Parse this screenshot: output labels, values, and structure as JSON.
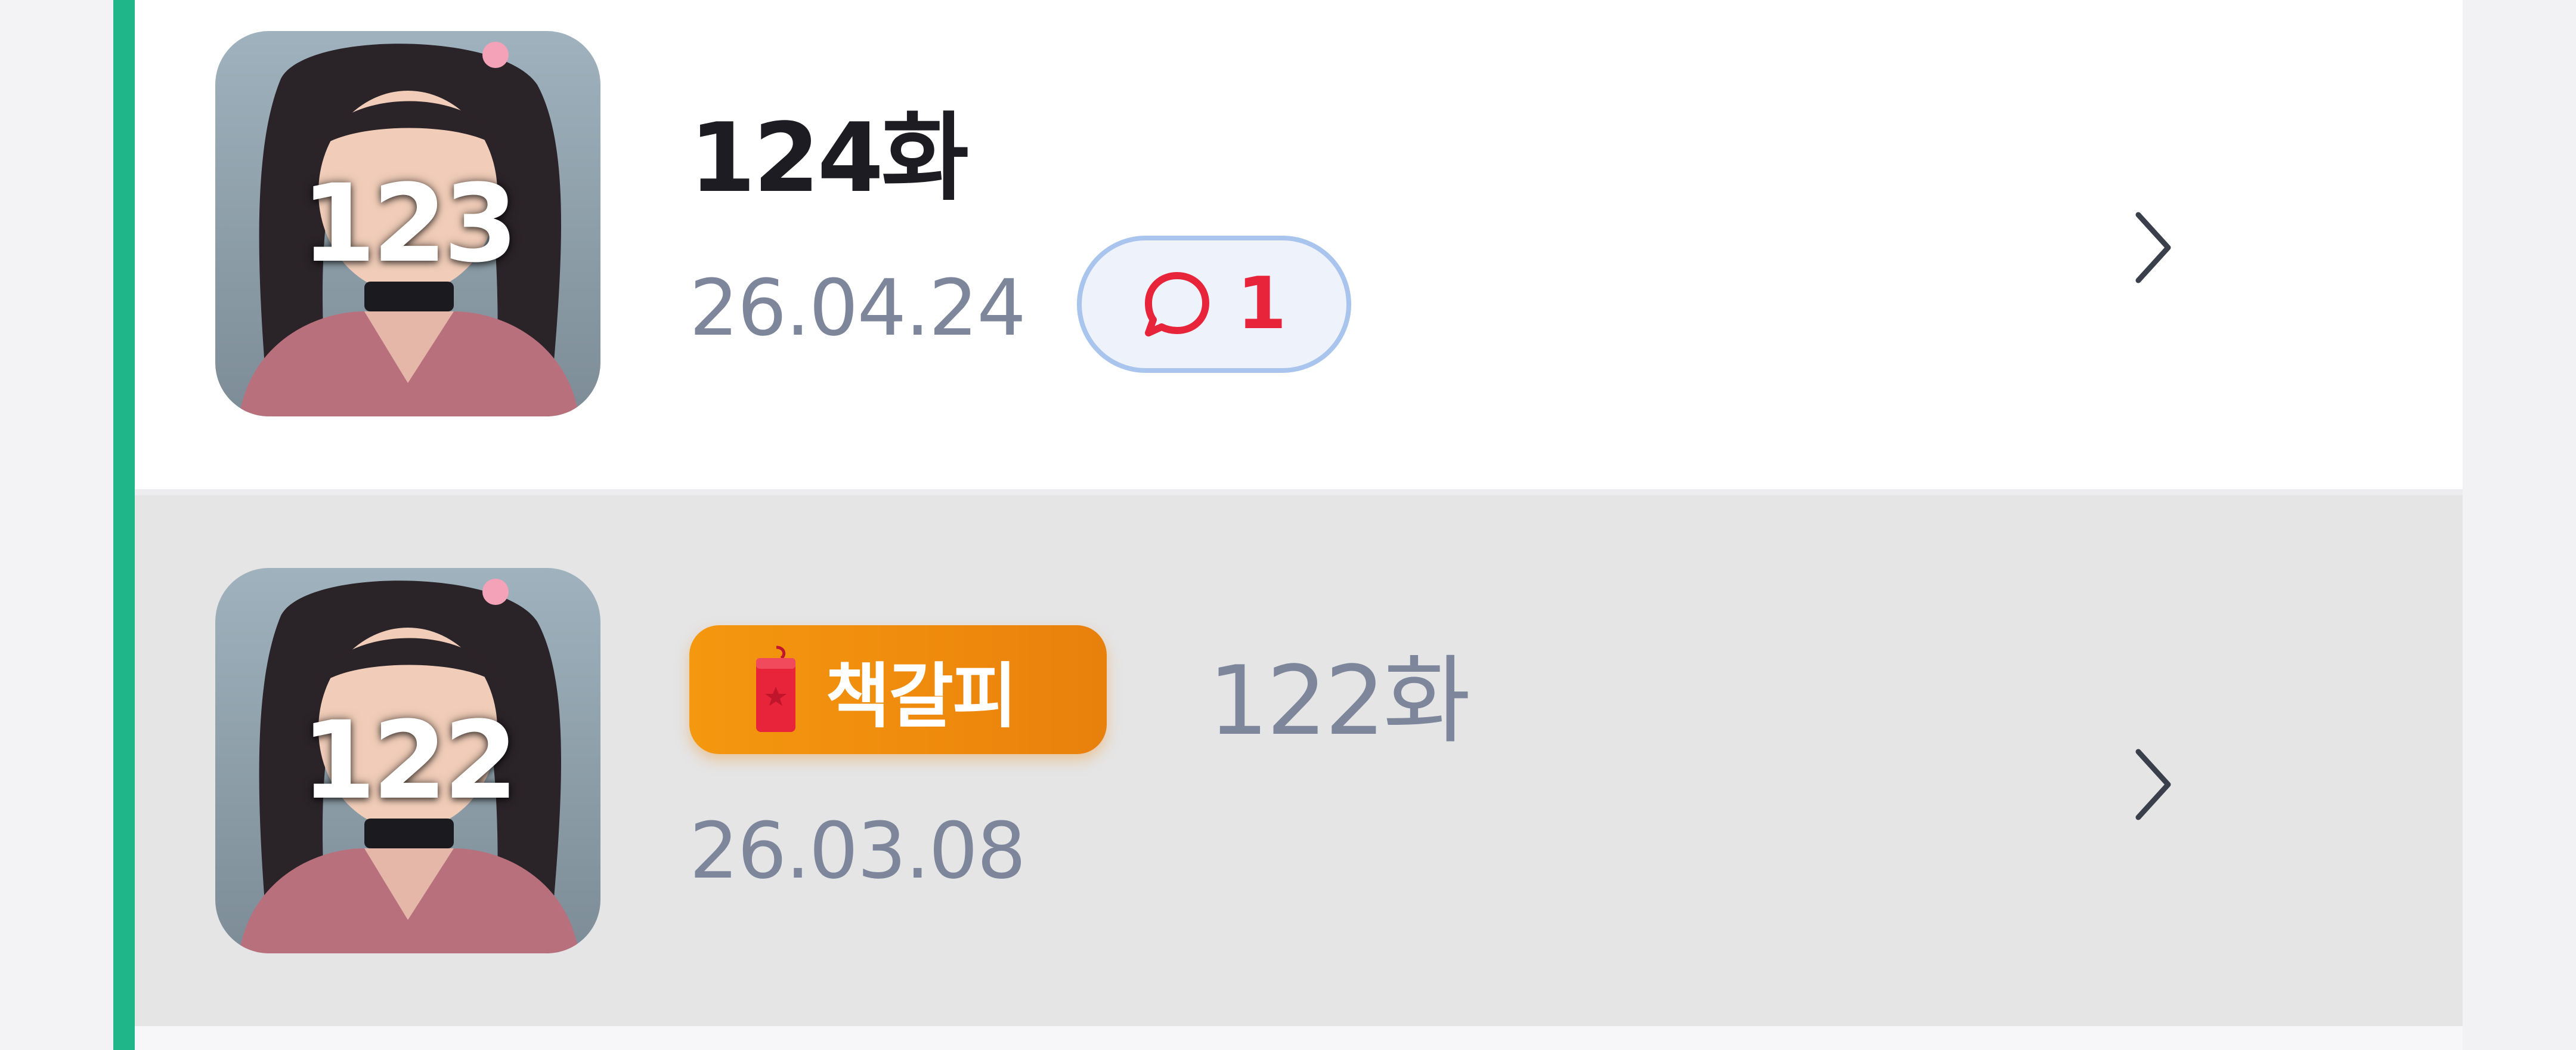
{
  "colors": {
    "accent_green": "#1fb68a",
    "title_dark": "#1c1c22",
    "muted_text": "#7d869b",
    "comment_red": "#e8243a",
    "bookmark_orange": "#f4980f"
  },
  "episodes": [
    {
      "thumbnail_number": "123",
      "title": "124화",
      "date": "26.04.24",
      "comment_icon": "speech-bubble-icon",
      "comment_count": "1",
      "chevron_icon": "chevron-right-icon"
    },
    {
      "thumbnail_number": "122",
      "title": "122화",
      "date": "26.03.08",
      "bookmark_icon": "bookmark-tag-icon",
      "bookmark_label": "책갈피",
      "chevron_icon": "chevron-right-icon"
    }
  ]
}
